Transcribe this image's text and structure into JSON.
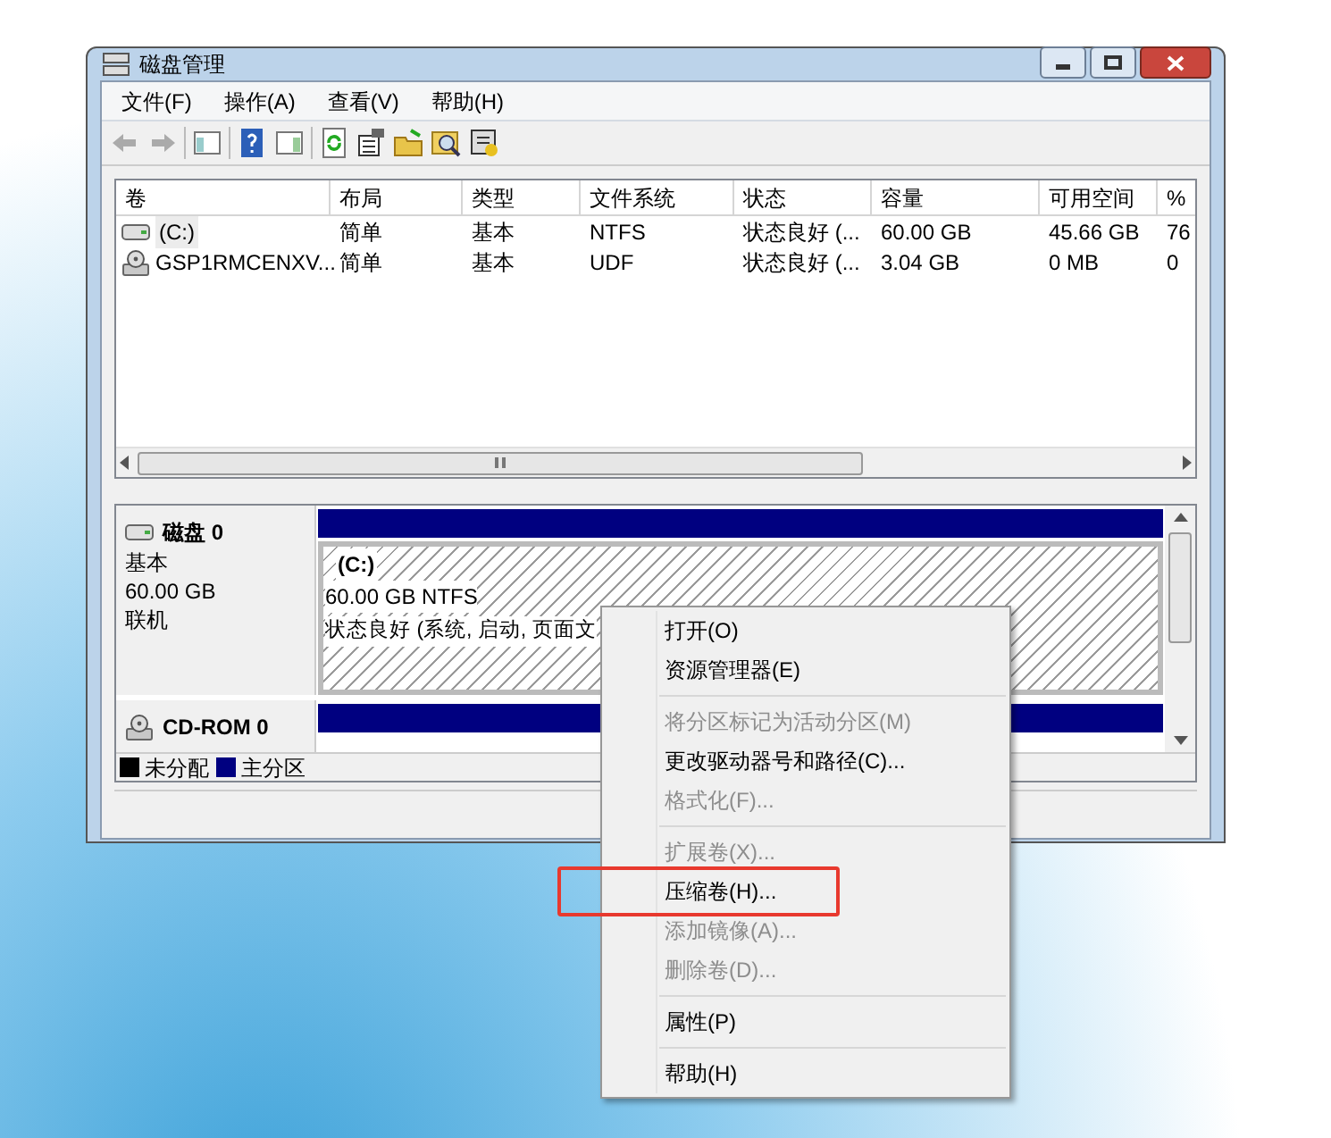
{
  "window": {
    "title": "磁盘管理"
  },
  "menu_bar": [
    "文件(F)",
    "操作(A)",
    "查看(V)",
    "帮助(H)"
  ],
  "volume_table": {
    "columns": [
      "卷",
      "布局",
      "类型",
      "文件系统",
      "状态",
      "容量",
      "可用空间",
      "%"
    ],
    "rows": [
      {
        "kind": "disk",
        "selected": true,
        "cells": [
          "(C:)",
          "简单",
          "基本",
          "NTFS",
          "状态良好 (...",
          "60.00 GB",
          "45.66 GB",
          "76"
        ]
      },
      {
        "kind": "cdrom",
        "selected": false,
        "cells": [
          "GSP1RMCENXV...",
          "简单",
          "基本",
          "UDF",
          "状态良好 (...",
          "3.04 GB",
          "0 MB",
          "0"
        ]
      }
    ]
  },
  "disks": [
    {
      "kind": "disk",
      "name": "磁盘 0",
      "details": [
        "基本",
        "60.00 GB",
        "联机"
      ],
      "partition": {
        "name": "(C:)",
        "size": "60.00 GB NTFS",
        "status": "状态良好 (系统, 启动, 页面文"
      }
    },
    {
      "kind": "cdrom",
      "name": "CD-ROM 0"
    }
  ],
  "legend": [
    {
      "label": "未分配",
      "color": "#000000"
    },
    {
      "label": "主分区",
      "color": "#000080"
    }
  ],
  "context_menu": [
    {
      "kind": "item",
      "label": "打开(O)",
      "disabled": false,
      "annotated": false
    },
    {
      "kind": "item",
      "label": "资源管理器(E)",
      "disabled": false,
      "annotated": false
    },
    {
      "kind": "separator"
    },
    {
      "kind": "item",
      "label": "将分区标记为活动分区(M)",
      "disabled": true,
      "annotated": false
    },
    {
      "kind": "item",
      "label": "更改驱动器号和路径(C)...",
      "disabled": false,
      "annotated": false
    },
    {
      "kind": "item",
      "label": "格式化(F)...",
      "disabled": true,
      "annotated": false
    },
    {
      "kind": "separator"
    },
    {
      "kind": "item",
      "label": "扩展卷(X)...",
      "disabled": true,
      "annotated": false
    },
    {
      "kind": "item",
      "label": "压缩卷(H)...",
      "disabled": false,
      "annotated": true
    },
    {
      "kind": "item",
      "label": "添加镜像(A)...",
      "disabled": true,
      "annotated": false
    },
    {
      "kind": "item",
      "label": "删除卷(D)...",
      "disabled": true,
      "annotated": false
    },
    {
      "kind": "separator"
    },
    {
      "kind": "item",
      "label": "属性(P)",
      "disabled": false,
      "annotated": false
    },
    {
      "kind": "separator"
    },
    {
      "kind": "item",
      "label": "帮助(H)",
      "disabled": false,
      "annotated": false
    }
  ]
}
